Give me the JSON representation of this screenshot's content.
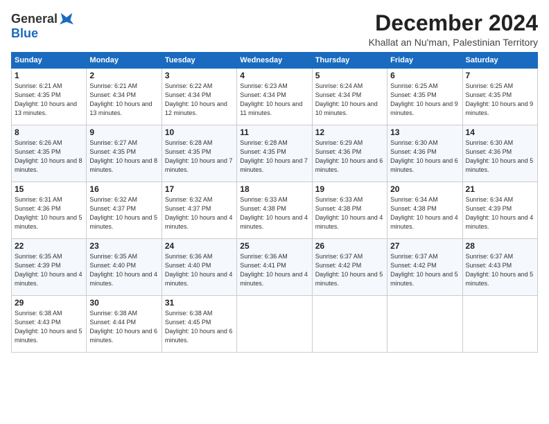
{
  "header": {
    "logo_general": "General",
    "logo_blue": "Blue",
    "title": "December 2024",
    "subtitle": "Khallat an Nu'man, Palestinian Territory"
  },
  "days_of_week": [
    "Sunday",
    "Monday",
    "Tuesday",
    "Wednesday",
    "Thursday",
    "Friday",
    "Saturday"
  ],
  "weeks": [
    [
      {
        "day": "1",
        "sunrise": "6:21 AM",
        "sunset": "4:35 PM",
        "daylight": "10 hours and 13 minutes."
      },
      {
        "day": "2",
        "sunrise": "6:21 AM",
        "sunset": "4:34 PM",
        "daylight": "10 hours and 13 minutes."
      },
      {
        "day": "3",
        "sunrise": "6:22 AM",
        "sunset": "4:34 PM",
        "daylight": "10 hours and 12 minutes."
      },
      {
        "day": "4",
        "sunrise": "6:23 AM",
        "sunset": "4:34 PM",
        "daylight": "10 hours and 11 minutes."
      },
      {
        "day": "5",
        "sunrise": "6:24 AM",
        "sunset": "4:34 PM",
        "daylight": "10 hours and 10 minutes."
      },
      {
        "day": "6",
        "sunrise": "6:25 AM",
        "sunset": "4:35 PM",
        "daylight": "10 hours and 9 minutes."
      },
      {
        "day": "7",
        "sunrise": "6:25 AM",
        "sunset": "4:35 PM",
        "daylight": "10 hours and 9 minutes."
      }
    ],
    [
      {
        "day": "8",
        "sunrise": "6:26 AM",
        "sunset": "4:35 PM",
        "daylight": "10 hours and 8 minutes."
      },
      {
        "day": "9",
        "sunrise": "6:27 AM",
        "sunset": "4:35 PM",
        "daylight": "10 hours and 8 minutes."
      },
      {
        "day": "10",
        "sunrise": "6:28 AM",
        "sunset": "4:35 PM",
        "daylight": "10 hours and 7 minutes."
      },
      {
        "day": "11",
        "sunrise": "6:28 AM",
        "sunset": "4:35 PM",
        "daylight": "10 hours and 7 minutes."
      },
      {
        "day": "12",
        "sunrise": "6:29 AM",
        "sunset": "4:36 PM",
        "daylight": "10 hours and 6 minutes."
      },
      {
        "day": "13",
        "sunrise": "6:30 AM",
        "sunset": "4:36 PM",
        "daylight": "10 hours and 6 minutes."
      },
      {
        "day": "14",
        "sunrise": "6:30 AM",
        "sunset": "4:36 PM",
        "daylight": "10 hours and 5 minutes."
      }
    ],
    [
      {
        "day": "15",
        "sunrise": "6:31 AM",
        "sunset": "4:36 PM",
        "daylight": "10 hours and 5 minutes."
      },
      {
        "day": "16",
        "sunrise": "6:32 AM",
        "sunset": "4:37 PM",
        "daylight": "10 hours and 5 minutes."
      },
      {
        "day": "17",
        "sunrise": "6:32 AM",
        "sunset": "4:37 PM",
        "daylight": "10 hours and 4 minutes."
      },
      {
        "day": "18",
        "sunrise": "6:33 AM",
        "sunset": "4:38 PM",
        "daylight": "10 hours and 4 minutes."
      },
      {
        "day": "19",
        "sunrise": "6:33 AM",
        "sunset": "4:38 PM",
        "daylight": "10 hours and 4 minutes."
      },
      {
        "day": "20",
        "sunrise": "6:34 AM",
        "sunset": "4:38 PM",
        "daylight": "10 hours and 4 minutes."
      },
      {
        "day": "21",
        "sunrise": "6:34 AM",
        "sunset": "4:39 PM",
        "daylight": "10 hours and 4 minutes."
      }
    ],
    [
      {
        "day": "22",
        "sunrise": "6:35 AM",
        "sunset": "4:39 PM",
        "daylight": "10 hours and 4 minutes."
      },
      {
        "day": "23",
        "sunrise": "6:35 AM",
        "sunset": "4:40 PM",
        "daylight": "10 hours and 4 minutes."
      },
      {
        "day": "24",
        "sunrise": "6:36 AM",
        "sunset": "4:40 PM",
        "daylight": "10 hours and 4 minutes."
      },
      {
        "day": "25",
        "sunrise": "6:36 AM",
        "sunset": "4:41 PM",
        "daylight": "10 hours and 4 minutes."
      },
      {
        "day": "26",
        "sunrise": "6:37 AM",
        "sunset": "4:42 PM",
        "daylight": "10 hours and 5 minutes."
      },
      {
        "day": "27",
        "sunrise": "6:37 AM",
        "sunset": "4:42 PM",
        "daylight": "10 hours and 5 minutes."
      },
      {
        "day": "28",
        "sunrise": "6:37 AM",
        "sunset": "4:43 PM",
        "daylight": "10 hours and 5 minutes."
      }
    ],
    [
      {
        "day": "29",
        "sunrise": "6:38 AM",
        "sunset": "4:43 PM",
        "daylight": "10 hours and 5 minutes."
      },
      {
        "day": "30",
        "sunrise": "6:38 AM",
        "sunset": "4:44 PM",
        "daylight": "10 hours and 6 minutes."
      },
      {
        "day": "31",
        "sunrise": "6:38 AM",
        "sunset": "4:45 PM",
        "daylight": "10 hours and 6 minutes."
      },
      null,
      null,
      null,
      null
    ]
  ]
}
